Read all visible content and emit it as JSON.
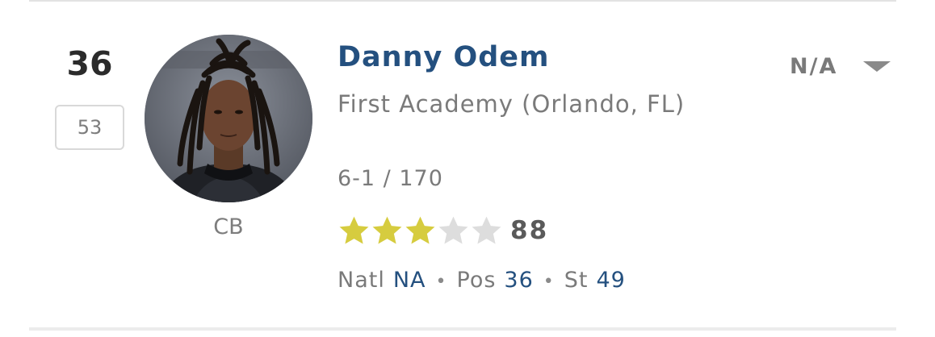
{
  "player": {
    "rank": "36",
    "previous_rank": "53",
    "name": "Danny Odem",
    "school": "First Academy (Orlando, FL)",
    "measurables": "6-1 / 170",
    "position": "CB",
    "stars": {
      "filled": 3,
      "total": 5
    },
    "rating": "88",
    "commit_status": "N/A"
  },
  "ranks": {
    "natl_label": "Natl",
    "natl_value": "NA",
    "pos_label": "Pos",
    "pos_value": "36",
    "st_label": "St",
    "st_value": "49",
    "separator": "•"
  },
  "colors": {
    "name": "#24507f",
    "star_filled": "#d6cc3f",
    "star_empty": "#dddddd",
    "rank_values": "#24507f"
  },
  "icons": {
    "star": "star-icon",
    "dropdown": "chevron-down-icon"
  }
}
